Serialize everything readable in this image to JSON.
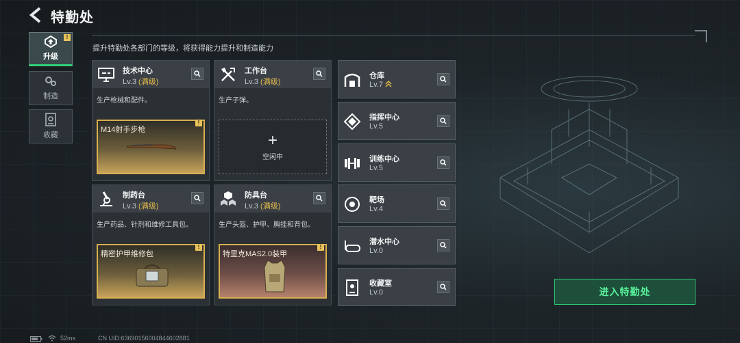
{
  "header": {
    "title": "特勤处",
    "subtitle": "提升特勤处各部门的等级，将获得能力提升和制造能力"
  },
  "nav": [
    {
      "label": "升级",
      "active": true,
      "badge": "!"
    },
    {
      "label": "制造",
      "active": false
    },
    {
      "label": "收藏",
      "active": false
    }
  ],
  "cards": [
    {
      "name": "技术中心",
      "level": "Lv.3",
      "max": "(满级)",
      "desc": "生产枪械和配件。",
      "slot": {
        "type": "item",
        "name": "M14射手步枪",
        "badge": "!"
      }
    },
    {
      "name": "工作台",
      "level": "Lv.3",
      "max": "(满级)",
      "desc": "生产子弹。",
      "slot": {
        "type": "idle",
        "plus": "+",
        "label": "空闲中"
      }
    },
    {
      "name": "制药台",
      "level": "Lv.3",
      "max": "(满级)",
      "desc": "生产药品、针剂和维修工具包。",
      "slot": {
        "type": "item",
        "name": "精密护甲维修包",
        "badge": "!"
      }
    },
    {
      "name": "防具台",
      "level": "Lv.3",
      "max": "(满级)",
      "desc": "生产头盔、护甲、胸挂和背包。",
      "slot": {
        "type": "item",
        "name": "特里克MAS2.0装甲",
        "badge": "!"
      }
    }
  ],
  "facilities": [
    {
      "name": "仓库",
      "level": "Lv.7"
    },
    {
      "name": "指挥中心",
      "level": "Lv.5"
    },
    {
      "name": "训练中心",
      "level": "Lv.5"
    },
    {
      "name": "靶场",
      "level": "Lv.4"
    },
    {
      "name": "潜水中心",
      "level": "Lv.0"
    },
    {
      "name": "收藏室",
      "level": "Lv.0"
    }
  ],
  "enter_button": "进入特勤处",
  "status": {
    "ping": "52ms",
    "uid": "CN UID:6369015600484460288​1"
  },
  "colors": {
    "accent": "#2fd07a",
    "gold": "#e4b94c",
    "badge": "#e8c25a"
  }
}
